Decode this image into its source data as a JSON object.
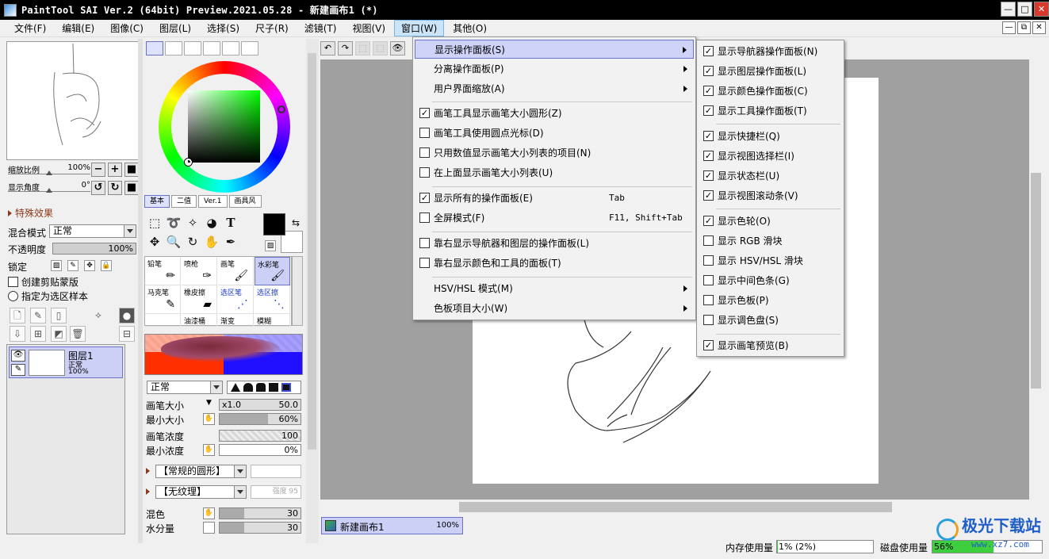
{
  "window": {
    "title": "PaintTool SAI Ver.2 (64bit) Preview.2021.05.28 - 新建画布1 (*)",
    "buttons": [
      "—",
      "□",
      "✕"
    ],
    "mdi_buttons": [
      "—",
      "⧉",
      "✕"
    ]
  },
  "menubar": [
    "文件(F)",
    "编辑(E)",
    "图像(C)",
    "图层(L)",
    "选择(S)",
    "尺子(R)",
    "滤镜(T)",
    "视图(V)",
    "窗口(W)",
    "其他(O)"
  ],
  "navigator": {
    "zoom_label": "缩放比例",
    "zoom_value": "100%",
    "angle_label": "显示角度",
    "angle_value": "0°"
  },
  "layer_panel": {
    "section_title": "特殊效果",
    "blend_label": "混合模式",
    "blend_value": "正常",
    "opacity_label": "不透明度",
    "opacity_value": "100%",
    "lock_label": "锁定",
    "clip_label": "创建剪贴蒙版",
    "select_source_label": "指定为选区样本",
    "layer": {
      "name": "图层1",
      "mode": "正常",
      "opacity": "100%"
    }
  },
  "tool_panel": {
    "brush_tabs": [
      "基本",
      "二值",
      "Ver.1",
      "画具风"
    ],
    "brushes": [
      {
        "label": "铅笔"
      },
      {
        "label": "喷枪"
      },
      {
        "label": "画笔"
      },
      {
        "label": "水彩笔"
      },
      {
        "label": "马克笔"
      },
      {
        "label": "橡皮擦"
      },
      {
        "label": "选区笔"
      },
      {
        "label": "选区擦"
      },
      {
        "label": ""
      },
      {
        "label": "油漆桶"
      },
      {
        "label": "渐变"
      },
      {
        "label": "模糊"
      }
    ],
    "mode_value": "正常",
    "params": {
      "size_label": "画笔大小",
      "size_mult": "x1.0",
      "size_value": "50.0",
      "min_size_label": "最小大小",
      "min_size_value": "60%",
      "density_label": "画笔浓度",
      "density_value": "100",
      "min_density_label": "最小浓度",
      "min_density_value": "0%",
      "shape_value": "【常规的圆形】",
      "texture_value": "【无纹理】",
      "texture_strength": "强度 95",
      "blend_label": "混色",
      "blend_value": "30",
      "water_label": "水分量",
      "water_value": "30"
    }
  },
  "document": {
    "tab_name": "新建画布1",
    "zoom": "100%"
  },
  "status": {
    "memory_label": "内存使用量",
    "memory_value": "1% (2%)",
    "memory_fraction": 0.01,
    "disk_label": "磁盘使用量",
    "disk_value": "56%",
    "disk_fraction": 0.56
  },
  "window_menu": [
    {
      "label": "显示操作面板(S)",
      "submenu": true,
      "highlight": true
    },
    {
      "label": "分离操作面板(P)",
      "submenu": true
    },
    {
      "label": "用户界面缩放(A)",
      "submenu": true
    },
    {
      "label": "画笔工具显示画笔大小圆形(Z)",
      "checked": true
    },
    {
      "label": "画笔工具使用圆点光标(D)",
      "checked": false
    },
    {
      "label": "只用数值显示画笔大小列表的项目(N)",
      "checked": false
    },
    {
      "label": "在上面显示画笔大小列表(U)",
      "checked": false
    },
    {
      "label": "显示所有的操作面板(E)",
      "checked": true,
      "accel": "Tab"
    },
    {
      "label": "全屏模式(F)",
      "checked": false,
      "accel": "F11, Shift+Tab"
    },
    {
      "label": "靠右显示导航器和图层的操作面板(L)",
      "checked": false
    },
    {
      "label": "靠右显示颜色和工具的面板(T)",
      "checked": false
    },
    {
      "label": "HSV/HSL 模式(M)",
      "submenu": true
    },
    {
      "label": "色板项目大小(W)",
      "submenu": true
    }
  ],
  "panel_submenu": [
    {
      "label": "显示导航器操作面板(N)",
      "checked": true
    },
    {
      "label": "显示图层操作面板(L)",
      "checked": true
    },
    {
      "label": "显示颜色操作面板(C)",
      "checked": true
    },
    {
      "label": "显示工具操作面板(T)",
      "checked": true
    },
    {
      "label": "显示快捷栏(Q)",
      "checked": true
    },
    {
      "label": "显示视图选择栏(I)",
      "checked": true
    },
    {
      "label": "显示状态栏(U)",
      "checked": true
    },
    {
      "label": "显示视图滚动条(V)",
      "checked": true
    },
    {
      "label": "显示色轮(O)",
      "checked": true
    },
    {
      "label": "显示 RGB 滑块",
      "checked": false
    },
    {
      "label": "显示 HSV/HSL 滑块",
      "checked": false
    },
    {
      "label": "显示中间色条(G)",
      "checked": false
    },
    {
      "label": "显示色板(P)",
      "checked": false
    },
    {
      "label": "显示调色盘(S)",
      "checked": false
    },
    {
      "label": "显示画笔预览(B)",
      "checked": true
    }
  ],
  "watermark": {
    "name": "极光下载站",
    "url": "www.xz7.com"
  },
  "colors": {
    "accent": "#6a72c9",
    "highlight": "#cfd3f7",
    "primary": "#000000",
    "secondary": "#ffffff"
  }
}
